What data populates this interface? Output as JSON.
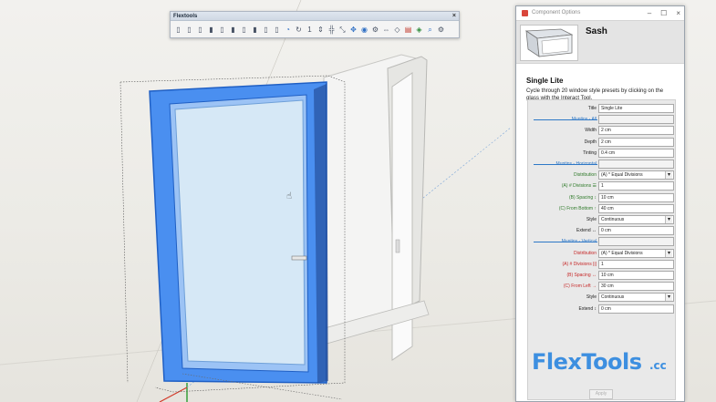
{
  "toolbar": {
    "title": "Flextools",
    "close": "×",
    "icons": [
      {
        "name": "door-tool-1-icon",
        "glyph": "▯",
        "tone": ""
      },
      {
        "name": "door-tool-2-icon",
        "glyph": "▯",
        "tone": ""
      },
      {
        "name": "door-tool-3-icon",
        "glyph": "▯",
        "tone": ""
      },
      {
        "name": "door-tool-4-icon",
        "glyph": "▮",
        "tone": ""
      },
      {
        "name": "window-tool-1-icon",
        "glyph": "▯",
        "tone": ""
      },
      {
        "name": "window-tool-2-icon",
        "glyph": "▮",
        "tone": ""
      },
      {
        "name": "window-tool-3-icon",
        "glyph": "▯",
        "tone": ""
      },
      {
        "name": "window-tool-4-icon",
        "glyph": "▮",
        "tone": ""
      },
      {
        "name": "window-tool-5-icon",
        "glyph": "▯",
        "tone": ""
      },
      {
        "name": "window-tool-6-icon",
        "glyph": "▯",
        "tone": ""
      },
      {
        "name": "stair-tool-icon",
        "glyph": "◔",
        "tone": "blue"
      },
      {
        "name": "rotate-tool-icon",
        "glyph": "↻",
        "tone": ""
      },
      {
        "name": "number-tool-icon",
        "glyph": "1",
        "tone": ""
      },
      {
        "name": "dimension-tool-icon",
        "glyph": "⇕",
        "tone": ""
      },
      {
        "name": "align-tool-icon",
        "glyph": "╬",
        "tone": ""
      },
      {
        "name": "scale-tool-icon",
        "glyph": "⤡",
        "tone": ""
      },
      {
        "name": "move-tool-icon",
        "glyph": "✥",
        "tone": "blue"
      },
      {
        "name": "compass-tool-icon",
        "glyph": "◉",
        "tone": "blue"
      },
      {
        "name": "section-tool-icon",
        "glyph": "⚙",
        "tone": ""
      },
      {
        "name": "mirror-tool-icon",
        "glyph": "⇔",
        "tone": ""
      },
      {
        "name": "flip-tool-icon",
        "glyph": "◇",
        "tone": ""
      },
      {
        "name": "paint-tool-icon",
        "glyph": "▤",
        "tone": "red"
      },
      {
        "name": "material-tool-icon",
        "glyph": "◈",
        "tone": "green"
      },
      {
        "name": "magnify-tool-icon",
        "glyph": "⌕",
        "tone": "blue"
      },
      {
        "name": "settings-tool-icon",
        "glyph": "⚙",
        "tone": ""
      }
    ]
  },
  "dialog": {
    "title": "Component Options",
    "win_min": "–",
    "win_max": "☐",
    "win_close": "×",
    "component_name": "Sash",
    "preset_title": "Single Lite",
    "preset_desc": "Cycle through 20 window style presets by clicking on the glass with the Interact Tool.",
    "fields": [
      {
        "kind": "field",
        "label": "Title",
        "value": "Single Lite",
        "tone": ""
      },
      {
        "kind": "section",
        "label": "Muntins - All"
      },
      {
        "kind": "field",
        "label": "Width",
        "value": "2 cm",
        "tone": ""
      },
      {
        "kind": "field",
        "label": "Depth",
        "value": "2 cm",
        "tone": ""
      },
      {
        "kind": "field",
        "label": "Tinting",
        "value": "0.4 cm",
        "tone": ""
      },
      {
        "kind": "section",
        "label": "Muntins - Horizontal"
      },
      {
        "kind": "select",
        "label": "Distribution",
        "value": "(A) * Equal Divisions",
        "tone": "green"
      },
      {
        "kind": "field",
        "label": "(A) # Divisions ☰",
        "value": "1",
        "tone": "green"
      },
      {
        "kind": "field",
        "label": "(B) Spacing ↕",
        "value": "10 cm",
        "tone": "green"
      },
      {
        "kind": "field",
        "label": "(C) From Bottom ↑",
        "value": "40 cm",
        "tone": "green"
      },
      {
        "kind": "select",
        "label": "Style",
        "value": "Continuous",
        "tone": ""
      },
      {
        "kind": "field",
        "label": "Extend ↔",
        "value": "0 cm",
        "tone": ""
      },
      {
        "kind": "section",
        "label": "Muntins - Vertical"
      },
      {
        "kind": "select",
        "label": "Distribution",
        "value": "(A) * Equal Divisions",
        "tone": "red"
      },
      {
        "kind": "field",
        "label": "(A) # Divisions |||",
        "value": "1",
        "tone": "red"
      },
      {
        "kind": "field",
        "label": "(B) Spacing ↔",
        "value": "10 cm",
        "tone": "red"
      },
      {
        "kind": "field",
        "label": "(C) From Left →",
        "value": "30 cm",
        "tone": "red"
      },
      {
        "kind": "select",
        "label": "Style",
        "value": "Continuous",
        "tone": ""
      },
      {
        "kind": "field",
        "label": "Extend ↕",
        "value": "0 cm",
        "tone": ""
      }
    ],
    "brand": "FlexTools",
    "brand_suffix": ".cc",
    "apply_label": "Apply"
  },
  "colors": {
    "selection_blue": "#4a8ff0",
    "glass": "#d6e8f6",
    "accent_green": "#2f7a2a",
    "accent_red": "#c62828",
    "brand_blue": "#3d8fe0"
  }
}
